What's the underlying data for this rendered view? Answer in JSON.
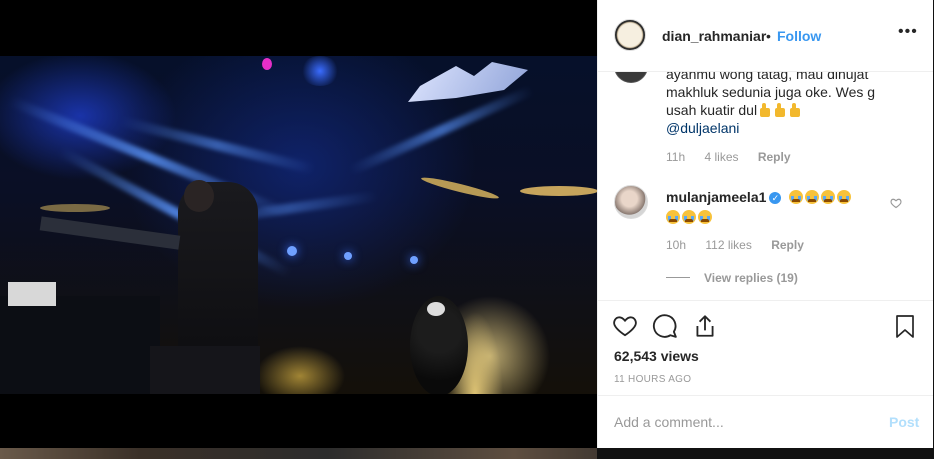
{
  "post": {
    "username": "dian_rahmaniar",
    "separator": "•",
    "follow_label": "Follow",
    "more_icon": "•••"
  },
  "comments": [
    {
      "text_lines": [
        "ayahmu wong tatag, mau dihujat",
        "makhluk sedunia juga oke. Wes g",
        "usah kuatir dul"
      ],
      "mention": "@duljaelani",
      "emoji": [
        "thumbs-up",
        "thumbs-up",
        "thumbs-up"
      ],
      "time": "11h",
      "likes": "4 likes",
      "reply_label": "Reply"
    },
    {
      "username": "mulanjameela1",
      "emoji": [
        "crying-face",
        "crying-face",
        "crying-face",
        "crying-face",
        "crying-face",
        "crying-face",
        "crying-face"
      ],
      "time": "10h",
      "likes": "112 likes",
      "reply_label": "Reply",
      "view_replies": "View replies (19)"
    }
  ],
  "stats": {
    "views": "62,543 views",
    "time_ago": "11 HOURS AGO"
  },
  "add_comment": {
    "placeholder": "Add a comment...",
    "post_label": "Post"
  },
  "colors": {
    "link": "#3897f0",
    "post_disabled": "#b2dffc",
    "muted": "#999999",
    "text": "#262626"
  },
  "icons": [
    "heart-icon",
    "comment-icon",
    "share-icon",
    "bookmark-icon",
    "more-options-icon",
    "verified-badge-icon"
  ]
}
